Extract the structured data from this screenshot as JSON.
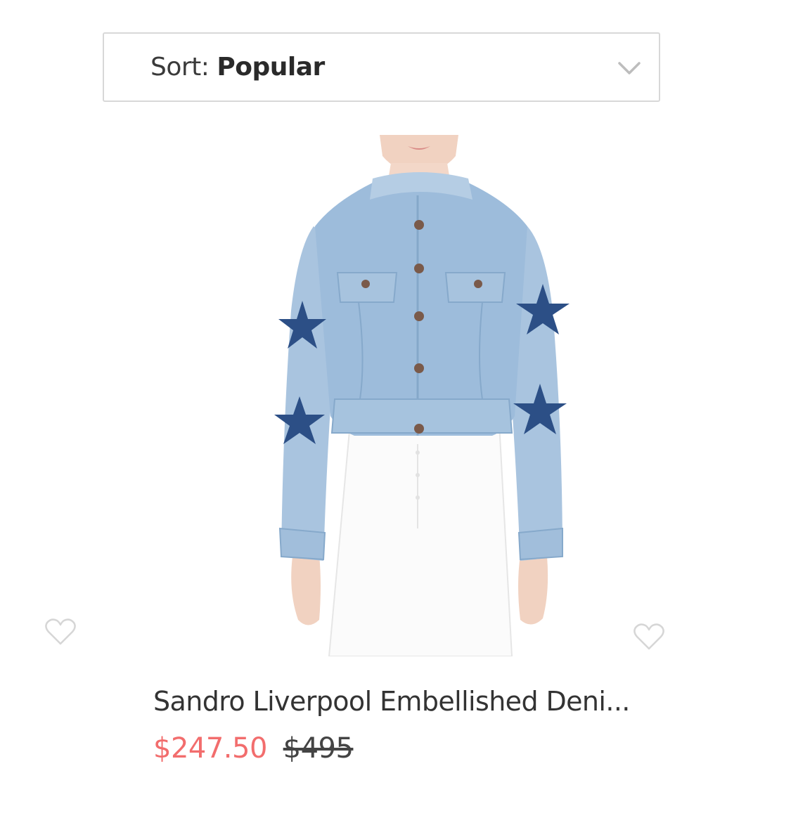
{
  "sort": {
    "label": "Sort:",
    "value": "Popular"
  },
  "icons": {
    "sort_dropdown": "chevron-down-icon",
    "wishlist": "heart-outline-icon"
  },
  "product": {
    "image_description": "Light-wash cropped denim jacket with navy star appliqués on sleeves, worn with white jeans",
    "name": "Sandro Liverpool Embellished Deni...",
    "sale_price": "$247.50",
    "original_price": "$495"
  },
  "colors": {
    "sale_price": "#f26d6d",
    "border": "#d8d8d8",
    "denim": "#9cb9d6",
    "star": "#2c4f86"
  }
}
